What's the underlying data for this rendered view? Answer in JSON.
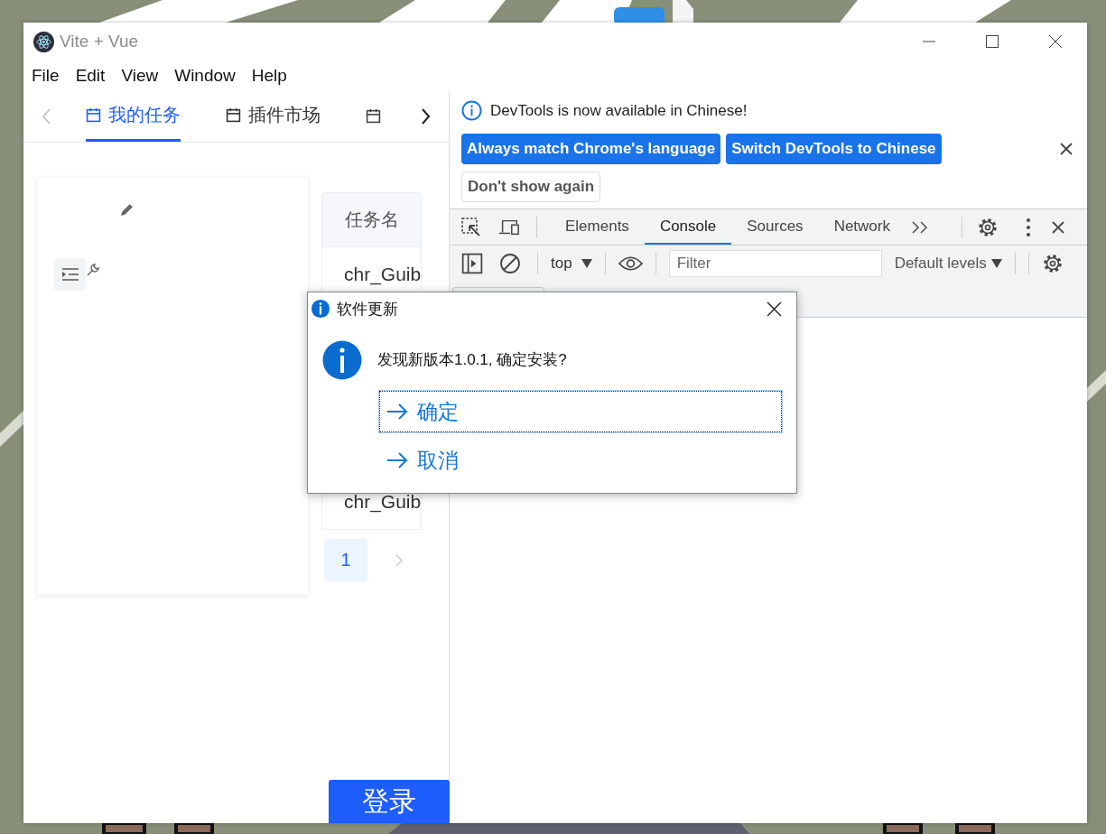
{
  "window": {
    "title": "Vite + Vue"
  },
  "menu": [
    "File",
    "Edit",
    "View",
    "Window",
    "Help"
  ],
  "app": {
    "tabs": [
      {
        "label": "我的任务",
        "selected": true
      },
      {
        "label": "插件市场",
        "selected": false
      }
    ],
    "table": {
      "columns": [
        "任务名"
      ],
      "rows": [
        [
          "chr_Guib"
        ],
        [
          "chr_Guib"
        ]
      ]
    },
    "pagination": {
      "pages": [
        {
          "label": "1",
          "selected": true
        }
      ]
    },
    "login_button": "登录"
  },
  "devtools": {
    "infobar": {
      "message": "DevTools is now available in Chinese!",
      "buttons": [
        {
          "label": "Always match Chrome's language",
          "kind": "primary"
        },
        {
          "label": "Switch DevTools to Chinese",
          "kind": "primary"
        },
        {
          "label": "Don't show again",
          "kind": "secondary"
        }
      ]
    },
    "tabs": [
      {
        "label": "Elements",
        "selected": false
      },
      {
        "label": "Console",
        "selected": true
      },
      {
        "label": "Sources",
        "selected": false
      },
      {
        "label": "Network",
        "selected": false
      }
    ],
    "console_toolbar": {
      "context": "top",
      "filter": {
        "placeholder": "Filter"
      },
      "levels": "Default levels"
    }
  },
  "dialog": {
    "title": "软件更新",
    "message": "发现新版本1.0.1, 确定安装?",
    "commands": [
      {
        "label": "确定",
        "focused": true
      },
      {
        "label": "取消",
        "focused": false
      }
    ]
  }
}
